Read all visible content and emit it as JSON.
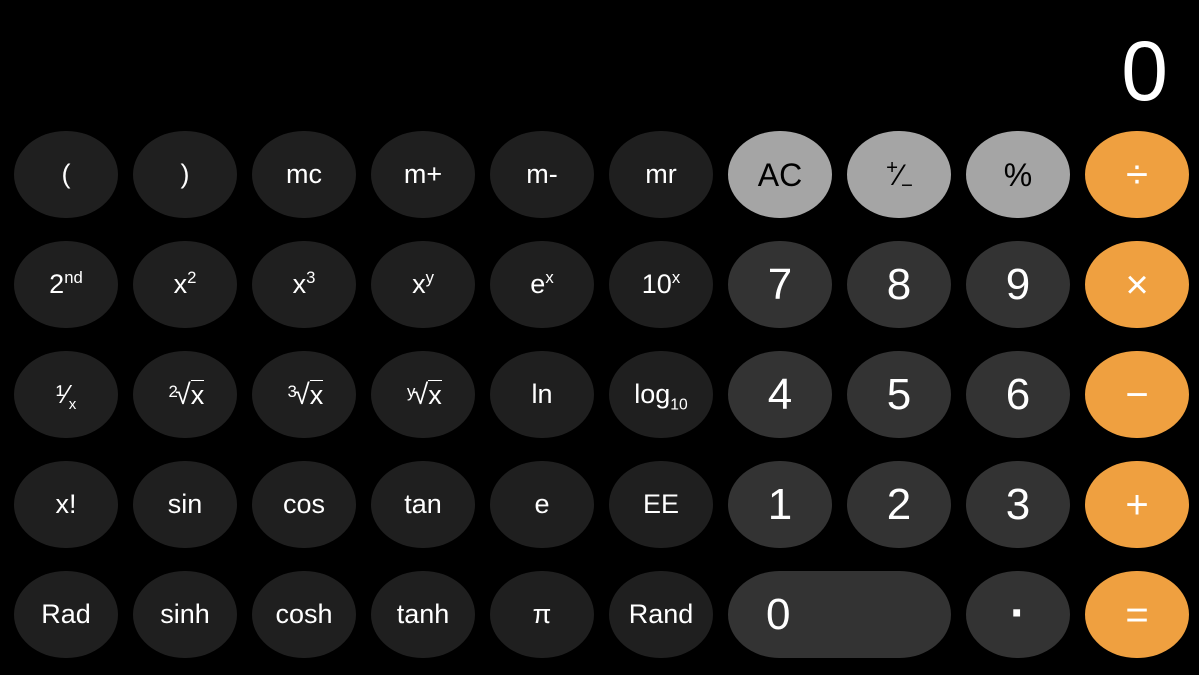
{
  "app": {
    "name": "Calculator",
    "mode": "scientific",
    "orientation": "landscape"
  },
  "display": {
    "value": "0",
    "text_color": "#ffffff",
    "background": "#000000",
    "align": "right"
  },
  "colors": {
    "background": "#000000",
    "function_key": "#1f1f1f",
    "digit_key": "#333333",
    "utility_key": "#a5a5a5",
    "operator_key": "#efa040",
    "label_light": "#ffffff",
    "label_dark": "#000000"
  },
  "keypad": {
    "rows": [
      {
        "index": 1,
        "keys": [
          {
            "label": "(",
            "name": "open-paren-key",
            "kind": "function"
          },
          {
            "label": ")",
            "name": "close-paren-key",
            "kind": "function"
          },
          {
            "label": "mc",
            "name": "memory-clear-key",
            "kind": "function"
          },
          {
            "label": "m+",
            "name": "memory-add-key",
            "kind": "function"
          },
          {
            "label": "m-",
            "name": "memory-subtract-key",
            "kind": "function"
          },
          {
            "label": "mr",
            "name": "memory-recall-key",
            "kind": "function"
          },
          {
            "label": "AC",
            "name": "all-clear-key",
            "kind": "utility"
          },
          {
            "label": "+/-",
            "name": "sign-toggle-key",
            "kind": "utility"
          },
          {
            "label": "%",
            "name": "percent-key",
            "kind": "utility"
          },
          {
            "label": "÷",
            "name": "divide-key",
            "kind": "operator"
          }
        ]
      },
      {
        "index": 2,
        "keys": [
          {
            "label": "2nd",
            "name": "second-function-key",
            "kind": "function"
          },
          {
            "label": "x2",
            "name": "square-key",
            "kind": "function"
          },
          {
            "label": "x3",
            "name": "cube-key",
            "kind": "function"
          },
          {
            "label": "xy",
            "name": "power-key",
            "kind": "function"
          },
          {
            "label": "ex",
            "name": "exp-e-key",
            "kind": "function"
          },
          {
            "label": "10x",
            "name": "exp-ten-key",
            "kind": "function"
          },
          {
            "label": "7",
            "name": "digit-7-key",
            "kind": "digit"
          },
          {
            "label": "8",
            "name": "digit-8-key",
            "kind": "digit"
          },
          {
            "label": "9",
            "name": "digit-9-key",
            "kind": "digit"
          },
          {
            "label": "×",
            "name": "multiply-key",
            "kind": "operator"
          }
        ]
      },
      {
        "index": 3,
        "keys": [
          {
            "label": "1/x",
            "name": "reciprocal-key",
            "kind": "function"
          },
          {
            "label": "2√x",
            "name": "square-root-key",
            "kind": "function"
          },
          {
            "label": "3√x",
            "name": "cube-root-key",
            "kind": "function"
          },
          {
            "label": "y√x",
            "name": "nth-root-key",
            "kind": "function"
          },
          {
            "label": "ln",
            "name": "natural-log-key",
            "kind": "function"
          },
          {
            "label": "log10",
            "name": "log-base-ten-key",
            "kind": "function"
          },
          {
            "label": "4",
            "name": "digit-4-key",
            "kind": "digit"
          },
          {
            "label": "5",
            "name": "digit-5-key",
            "kind": "digit"
          },
          {
            "label": "6",
            "name": "digit-6-key",
            "kind": "digit"
          },
          {
            "label": "−",
            "name": "subtract-key",
            "kind": "operator"
          }
        ]
      },
      {
        "index": 4,
        "keys": [
          {
            "label": "x!",
            "name": "factorial-key",
            "kind": "function"
          },
          {
            "label": "sin",
            "name": "sine-key",
            "kind": "function"
          },
          {
            "label": "cos",
            "name": "cosine-key",
            "kind": "function"
          },
          {
            "label": "tan",
            "name": "tangent-key",
            "kind": "function"
          },
          {
            "label": "e",
            "name": "euler-number-key",
            "kind": "function"
          },
          {
            "label": "EE",
            "name": "exponent-key",
            "kind": "function"
          },
          {
            "label": "1",
            "name": "digit-1-key",
            "kind": "digit"
          },
          {
            "label": "2",
            "name": "digit-2-key",
            "kind": "digit"
          },
          {
            "label": "3",
            "name": "digit-3-key",
            "kind": "digit"
          },
          {
            "label": "+",
            "name": "add-key",
            "kind": "operator"
          }
        ]
      },
      {
        "index": 5,
        "keys": [
          {
            "label": "Rad",
            "name": "radians-toggle-key",
            "kind": "function"
          },
          {
            "label": "sinh",
            "name": "sinh-key",
            "kind": "function"
          },
          {
            "label": "cosh",
            "name": "cosh-key",
            "kind": "function"
          },
          {
            "label": "tanh",
            "name": "tanh-key",
            "kind": "function"
          },
          {
            "label": "π",
            "name": "pi-key",
            "kind": "function"
          },
          {
            "label": "Rand",
            "name": "random-key",
            "kind": "function"
          },
          {
            "label": "0",
            "name": "digit-0-key",
            "kind": "digit",
            "wide": true
          },
          {
            "label": ".",
            "name": "decimal-point-key",
            "kind": "digit"
          },
          {
            "label": "=",
            "name": "equals-key",
            "kind": "operator"
          }
        ]
      }
    ]
  }
}
